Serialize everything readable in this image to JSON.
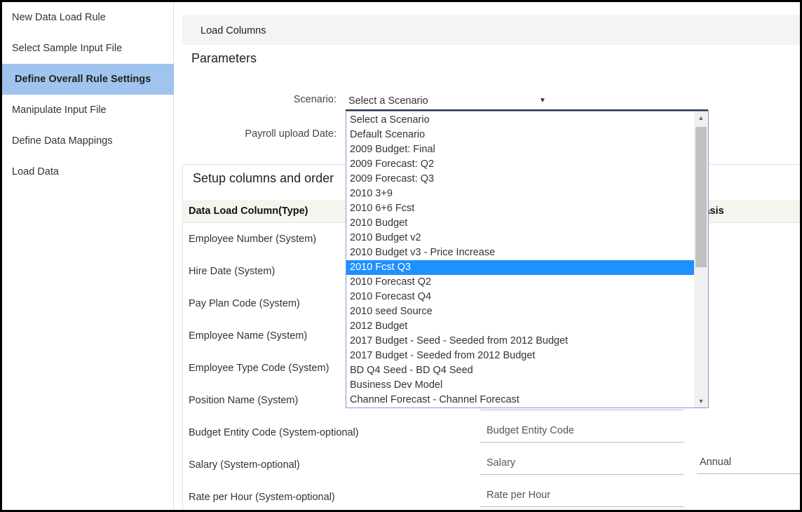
{
  "sidebar": {
    "items": [
      {
        "label": "New Data Load Rule",
        "active": false
      },
      {
        "label": "Select Sample Input File",
        "active": false
      },
      {
        "label": "Define Overall Rule Settings",
        "active": true
      },
      {
        "label": "Manipulate Input File",
        "active": false
      },
      {
        "label": "Define Data Mappings",
        "active": false
      },
      {
        "label": "Load Data",
        "active": false
      }
    ]
  },
  "load_columns_label": "Load Columns",
  "parameters": {
    "title": "Parameters",
    "scenario_label": "Scenario:",
    "scenario_value": "Select a Scenario",
    "payroll_label": "Payroll upload Date:"
  },
  "dropdown": {
    "highlighted_index": 10,
    "options": [
      "Select a Scenario",
      "Default Scenario",
      "2009 Budget: Final",
      "2009 Forecast: Q2",
      "2009 Forecast: Q3",
      "2010 3+9",
      "2010 6+6 Fcst",
      "2010 Budget",
      "2010 Budget v2",
      "2010 Budget v3 - Price Increase",
      "2010 Fcst Q3",
      "2010 Forecast Q2",
      "2010 Forecast Q4",
      "2010 seed Source",
      "2012 Budget",
      "2017 Budget - Seed - Seeded from 2012 Budget",
      "2017 Budget - Seeded from 2012 Budget",
      "BD Q4 Seed - BD Q4 Seed",
      "Business Dev Model",
      "Channel Forecast - Channel Forecast"
    ]
  },
  "setup": {
    "title": "Setup columns and order",
    "headers": {
      "column": "Data Load Column(Type)",
      "basis": "Basis"
    },
    "rows": [
      {
        "name": "Employee Number (System)",
        "input": "",
        "basis": ""
      },
      {
        "name": "Hire Date (System)",
        "input": "",
        "basis": ""
      },
      {
        "name": "Pay Plan Code (System)",
        "input": "",
        "basis": ""
      },
      {
        "name": "Employee Name (System)",
        "input": "",
        "basis": ""
      },
      {
        "name": "Employee Type Code (System)",
        "input": "",
        "basis": ""
      },
      {
        "name": "Position Name (System)",
        "input": "",
        "basis": ""
      },
      {
        "name": "Budget Entity Code (System-optional)",
        "input": "Budget Entity Code",
        "basis": ""
      },
      {
        "name": "Salary (System-optional)",
        "input": "Salary",
        "basis": "Annual"
      },
      {
        "name": "Rate per Hour (System-optional)",
        "input": "Rate per Hour",
        "basis": ""
      }
    ]
  },
  "colors": {
    "active_nav": "#a0c4ee",
    "highlight": "#1e90ff"
  }
}
